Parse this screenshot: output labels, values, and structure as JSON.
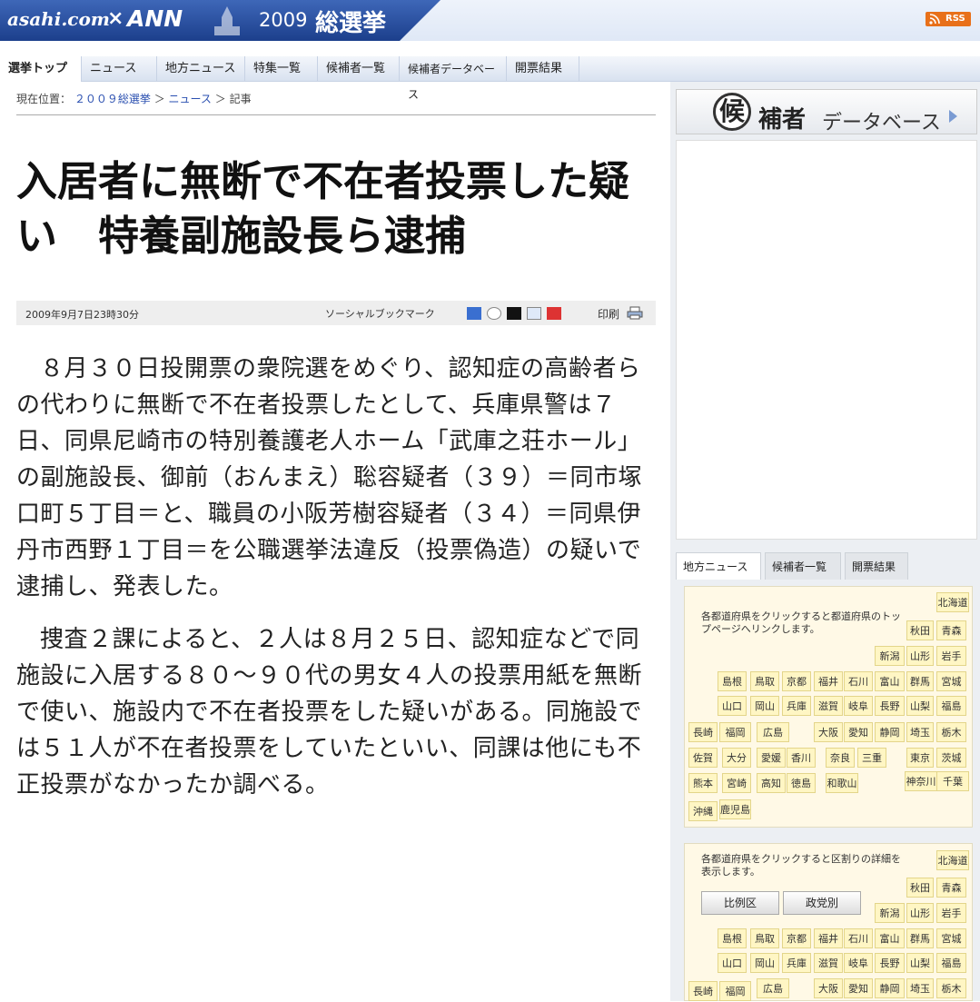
{
  "banner": {
    "site": "asahi.com",
    "cross": "×",
    "partner": "ANN",
    "year": "2009",
    "title": "総選挙",
    "rss": "RSS"
  },
  "nav": [
    "選挙トップ",
    "ニュース",
    "地方ニュース",
    "特集一覧",
    "候補者一覧",
    "候補者データベース",
    "開票結果"
  ],
  "breadcrumb": {
    "label": "現在位置：",
    "link1": "２００９総選挙",
    "sep1": "＞",
    "link2": "ニュース",
    "sep2": "＞",
    "current": "記事"
  },
  "article": {
    "headline": "入居者に無断で不在者投票した疑い　特養副施設長ら逮捕",
    "date": "2009年9月7日23時30分",
    "social_label": "ソーシャルブックマーク",
    "print_label": "印刷",
    "paragraphs": [
      "８月３０日投開票の衆院選をめぐり、認知症の高齢者らの代わりに無断で不在者投票したとして、兵庫県警は７日、同県尼崎市の特別養護老人ホーム「武庫之荘ホール」の副施設長、御前（おんまえ）聡容疑者（３９）＝同市塚口町５丁目＝と、職員の小阪芳樹容疑者（３４）＝同県伊丹市西野１丁目＝を公職選挙法違反（投票偽造）の疑いで逮捕し、発表した。",
      "捜査２課によると、２人は８月２５日、認知症などで同施設に入居する８０～９０代の男女４人の投票用紙を無断で使い、施設内で不在者投票をした疑いがある。同施設では５１人が不在者投票をしていたといい、同課は他にも不正投票がなかったか調べる。"
    ]
  },
  "sidebar": {
    "db_kou": "候",
    "db_ho": "補者",
    "db_rest": "データベース",
    "tabs": [
      "地方ニュース",
      "候補者一覧",
      "開票結果"
    ],
    "map1_note": "各都道府県をクリックすると都道府県のトップページへリンクします。",
    "map2_note": "各都道府県をクリックすると区割りの詳細を表示します。",
    "btn_hirei": "比例区",
    "btn_seito": "政党別",
    "prefs": [
      "北海道",
      "秋田",
      "青森",
      "新潟",
      "山形",
      "岩手",
      "島根",
      "鳥取",
      "京都",
      "福井",
      "石川",
      "富山",
      "群馬",
      "宮城",
      "山口",
      "岡山",
      "兵庫",
      "滋賀",
      "岐阜",
      "長野",
      "山梨",
      "福島",
      "長崎",
      "福岡",
      "広島",
      "大阪",
      "愛知",
      "静岡",
      "埼玉",
      "栃木",
      "佐賀",
      "大分",
      "愛媛",
      "香川",
      "奈良",
      "三重",
      "東京",
      "茨城",
      "熊本",
      "宮崎",
      "高知",
      "徳島",
      "和歌山",
      "神奈川",
      "千葉",
      "沖縄",
      "鹿児島"
    ],
    "prefs2": [
      "北海道",
      "秋田",
      "青森",
      "新潟",
      "山形",
      "岩手",
      "島根",
      "鳥取",
      "京都",
      "福井",
      "石川",
      "富山",
      "群馬",
      "宮城",
      "山口",
      "岡山",
      "兵庫",
      "滋賀",
      "岐阜",
      "長野",
      "山梨",
      "福島",
      "長崎",
      "福岡",
      "広島",
      "大阪",
      "愛知",
      "静岡",
      "埼玉",
      "栃木"
    ]
  },
  "colors": {
    "banner": "#1c3f8c",
    "rss": "#e8701a",
    "pref_bg": "#fff6c4"
  }
}
